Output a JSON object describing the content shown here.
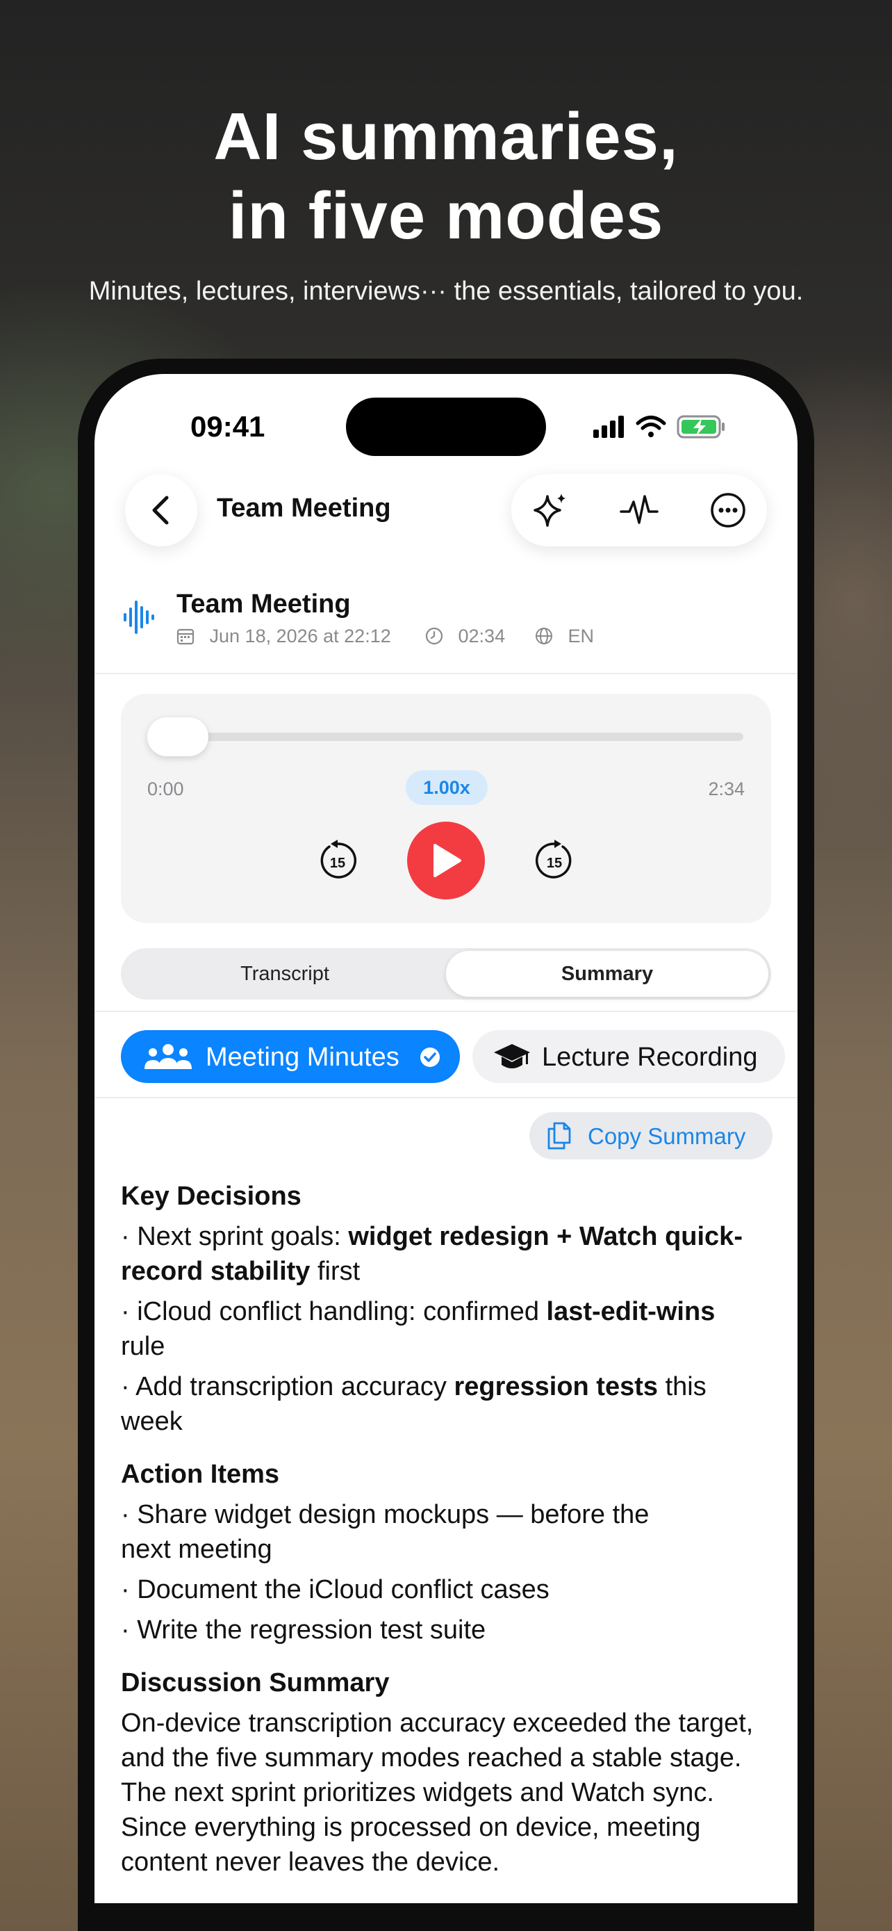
{
  "headline": {
    "line1": "AI summaries,",
    "line2": "in five modes",
    "subtitle": "Minutes, lectures, interviews··· the essentials, tailored to you."
  },
  "status_bar": {
    "time": "09:41"
  },
  "nav": {
    "title": "Team Meeting",
    "actions": [
      "sparkles-icon",
      "waveform-icon",
      "more-icon"
    ]
  },
  "recording": {
    "title": "Team Meeting",
    "date": "Jun 18, 2026 at 22:12",
    "duration": "02:34",
    "language": "EN"
  },
  "player": {
    "current_time": "0:00",
    "total_time": "2:34",
    "speed": "1.00x",
    "skip_back": "15",
    "skip_forward": "15",
    "progress_fraction": 0
  },
  "tabs": {
    "transcript": "Transcript",
    "summary": "Summary",
    "selected": "summary"
  },
  "modes": {
    "active": "Meeting Minutes",
    "next": "Lecture Recording"
  },
  "copy_summary": "Copy Summary",
  "summary": {
    "key_decisions_heading": "Key Decisions",
    "kd1": {
      "a": "· Next sprint goals: ",
      "b": "widget redesign + Watch quick-record stability",
      "c": " first"
    },
    "kd2": {
      "a": "· iCloud conflict handling: confirmed ",
      "b": "last-edit-wins",
      "c": " rule"
    },
    "kd3": {
      "a": "· Add transcription accuracy ",
      "b": "regression tests",
      "c": " this week"
    },
    "action_items_heading": "Action Items",
    "ai1": "· Share widget design mockups — before the next meeting",
    "ai2": "· Document the iCloud conflict cases",
    "ai3": "· Write the regression test suite",
    "discussion_heading": "Discussion Summary",
    "discussion_text": "On-device transcription accuracy exceeded the target, and the five summary modes reached a stable stage. The next sprint prioritizes widgets and Watch sync. Since everything is processed on device, meeting content never leaves the device."
  },
  "colors": {
    "accent": "#0a84ff",
    "play": "#f33c42",
    "battery": "#34c759"
  }
}
